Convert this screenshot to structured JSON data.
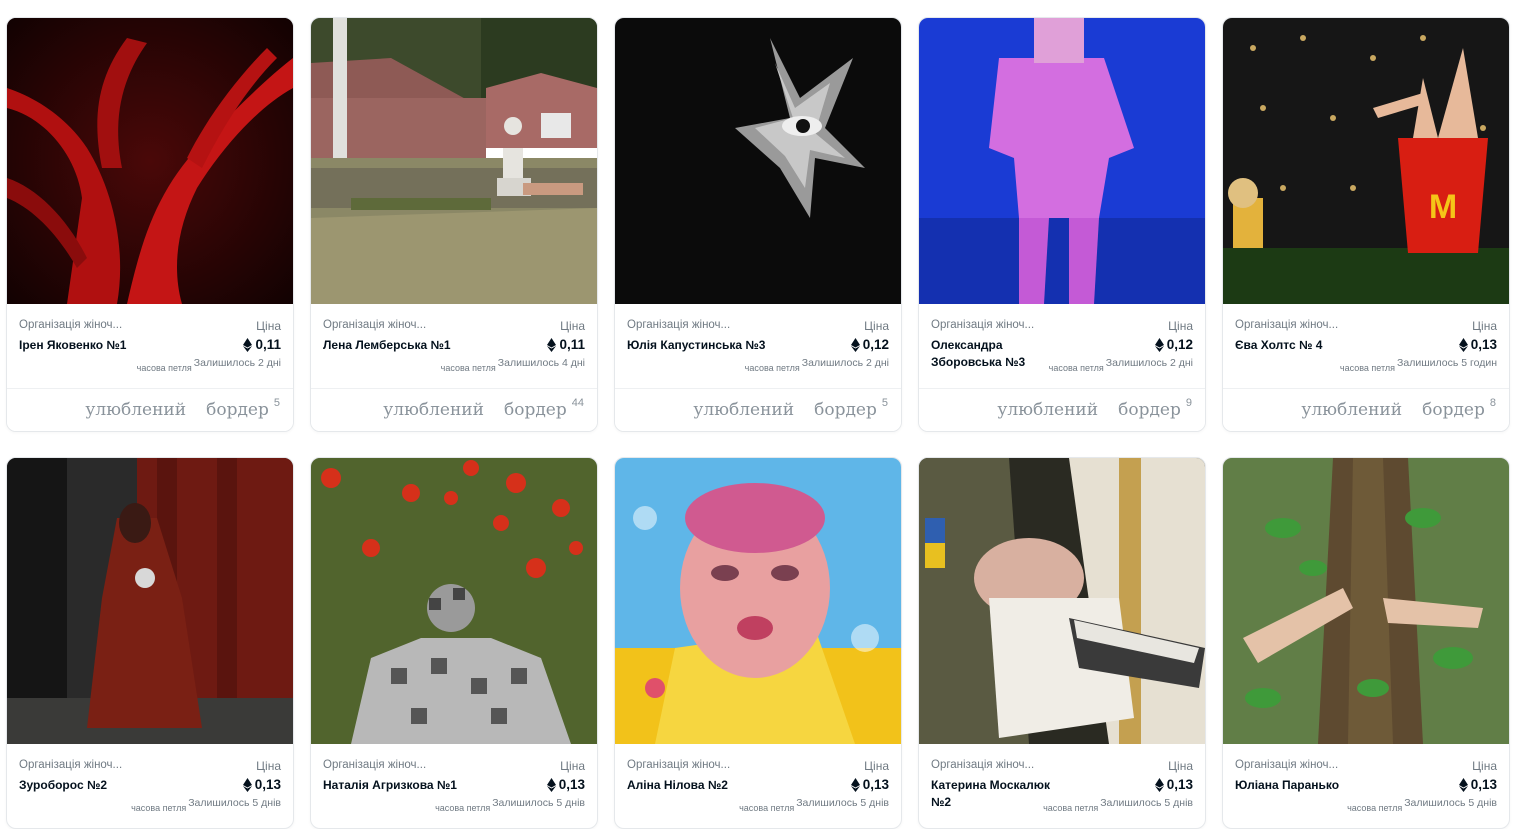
{
  "cards": [
    {
      "org": "Організація жіноч...",
      "name": "Ірен Яковенко №1",
      "price_label": "Ціна",
      "price": "0,11",
      "loop": "часова петля",
      "left": "Залишилось 2 дні",
      "favorite": "улюблений",
      "border": "бордер",
      "count": "5"
    },
    {
      "org": "Організація жіноч...",
      "name": "Лена Лемберська №1",
      "price_label": "Ціна",
      "price": "0,11",
      "loop": "часова петля",
      "left": "Залишилось 4 дні",
      "favorite": "улюблений",
      "border": "бордер",
      "count": "44"
    },
    {
      "org": "Організація жіноч...",
      "name": "Юлія Капустинська №3",
      "price_label": "Ціна",
      "price": "0,12",
      "loop": "часова петля",
      "left": "Залишилось 2 дні",
      "favorite": "улюблений",
      "border": "бордер",
      "count": "5"
    },
    {
      "org": "Організація жіноч...",
      "name": "Олександра Зборовська №3",
      "price_label": "Ціна",
      "price": "0,12",
      "loop": "часова петля",
      "left": "Залишилось 2 дні",
      "favorite": "улюблений",
      "border": "бордер",
      "count": "9"
    },
    {
      "org": "Організація жіноч...",
      "name": "Єва Холтс № 4",
      "price_label": "Ціна",
      "price": "0,13",
      "loop": "часова петля",
      "left": "Залишилось 5 годин",
      "favorite": "улюблений",
      "border": "бордер",
      "count": "8"
    },
    {
      "org": "Організація жіноч...",
      "name": "Зуроборос №2",
      "price_label": "Ціна",
      "price": "0,13",
      "loop": "часова петля",
      "left": "Залишилось 5 днів"
    },
    {
      "org": "Організація жіноч...",
      "name": "Наталія Агризкова №1",
      "price_label": "Ціна",
      "price": "0,13",
      "loop": "часова петля",
      "left": "Залишилось 5 днів"
    },
    {
      "org": "Організація жіноч...",
      "name": "Аліна Нілова №2",
      "price_label": "Ціна",
      "price": "0,13",
      "loop": "часова петля",
      "left": "Залишилось 5 днів"
    },
    {
      "org": "Організація жіноч...",
      "name": "Катерина Москалюк №2",
      "price_label": "Ціна",
      "price": "0,13",
      "loop": "часова петля",
      "left": "Залишилось 5 днів"
    },
    {
      "org": "Організація жіноч...",
      "name": "Юліана Паранько",
      "price_label": "Ціна",
      "price": "0,13",
      "loop": "часова петля",
      "left": "Залишилось 5 днів"
    }
  ],
  "icons": {
    "currency": "ethereum-icon"
  }
}
